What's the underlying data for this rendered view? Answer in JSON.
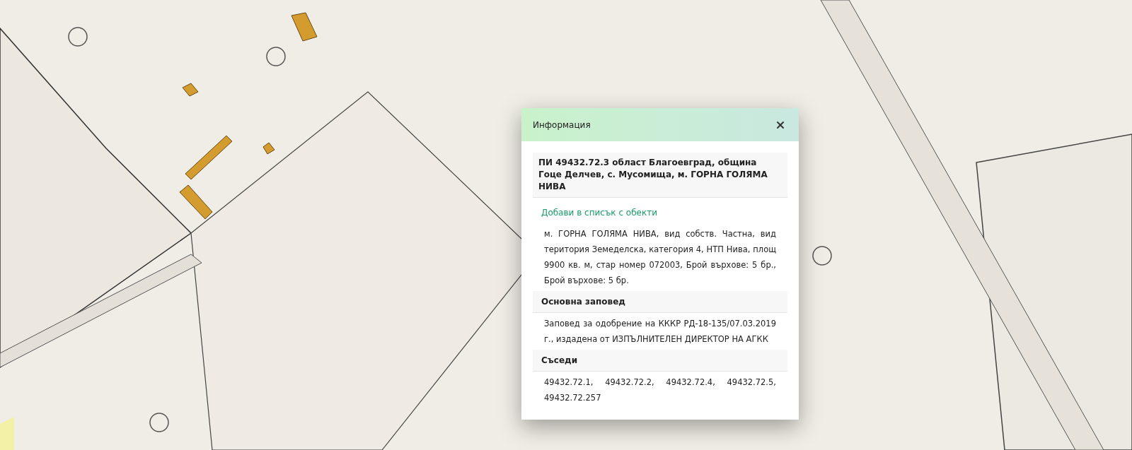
{
  "popup": {
    "title": "Информация",
    "parcel_title": "ПИ 49432.72.3 област Благоевград, община Гоце Делчев, с. Мусомища, м. ГОРНА ГОЛЯМА НИВА",
    "add_link": "Добави в списък с обекти",
    "description": "м. ГОРНА ГОЛЯМА НИВА, вид собств. Частна, вид територия Земеделска, категория 4, НТП Нива, площ 9900 кв. м, стар номер 072003, Брой върхове: 5 бр., Брой върхове: 5 бр.",
    "sections": [
      {
        "heading": "Основна заповед",
        "text": "Заповед за одобрение на КККР РД-18-135/07.03.2019 г., издадена от ИЗПЪЛНИТЕЛЕН ДИРЕКТОР НА АГКК"
      },
      {
        "heading": "Съседи",
        "text": "49432.72.1, 49432.72.2, 49432.72.4, 49432.72.5, 49432.72.257"
      }
    ]
  }
}
